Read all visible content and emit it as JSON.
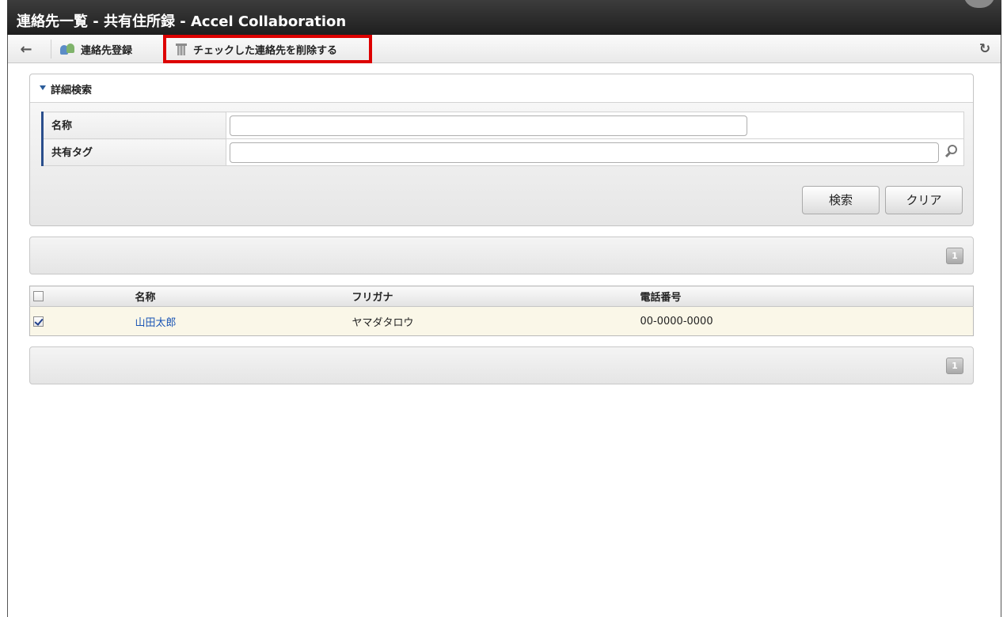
{
  "window": {
    "title": "連絡先一覧 - 共有住所録 - Accel Collaboration"
  },
  "toolbar": {
    "back_icon": "arrow-left-icon",
    "register_label": "連絡先登録",
    "delete_label": "チェックした連絡先を削除する",
    "refresh_icon": "refresh-icon"
  },
  "search": {
    "section_label": "詳細検索",
    "fields": [
      {
        "label": "名称",
        "value": ""
      },
      {
        "label": "共有タグ",
        "value": ""
      }
    ],
    "search_button": "検索",
    "clear_button": "クリア"
  },
  "pager": {
    "current_page": "1"
  },
  "table": {
    "headers": [
      "名称",
      "フリガナ",
      "電話番号"
    ],
    "rows": [
      {
        "checked": true,
        "name": "山田太郎",
        "kana": "ヤマダタロウ",
        "phone": "00-0000-0000"
      }
    ]
  },
  "colors": {
    "highlight": "#dd0000",
    "link": "#1a55b5",
    "row_bg": "#faf7e8"
  }
}
